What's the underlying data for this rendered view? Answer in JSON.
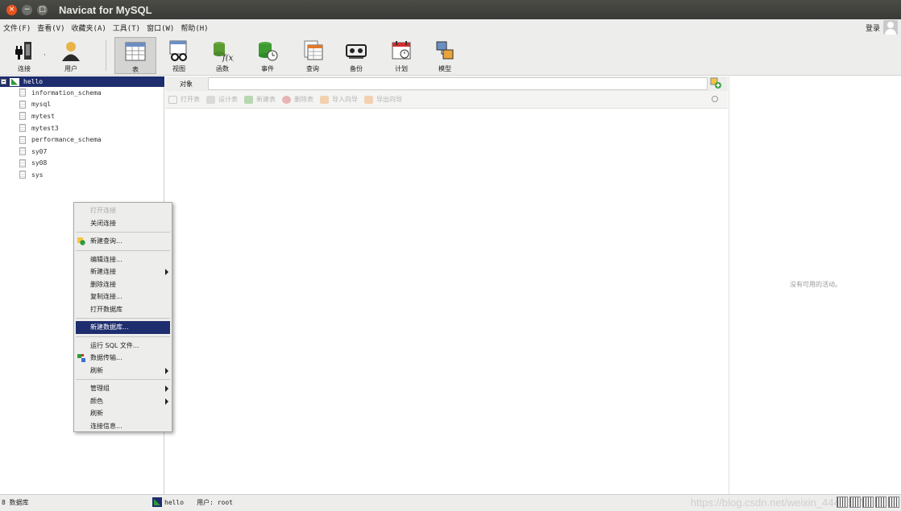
{
  "window": {
    "title": "Navicat for MySQL"
  },
  "menubar": {
    "items": [
      "文件(F)",
      "查看(V)",
      "收藏夹(A)",
      "工具(T)",
      "窗口(W)",
      "帮助(H)"
    ],
    "login": "登录"
  },
  "toolbar": {
    "items": [
      {
        "label": "连接",
        "icon": "plug-icon"
      },
      {
        "label": "用户",
        "icon": "user-icon"
      },
      {
        "label": "表",
        "icon": "table-icon"
      },
      {
        "label": "视图",
        "icon": "view-icon"
      },
      {
        "label": "函数",
        "icon": "function-icon"
      },
      {
        "label": "事件",
        "icon": "event-icon"
      },
      {
        "label": "查询",
        "icon": "query-icon"
      },
      {
        "label": "备份",
        "icon": "backup-icon"
      },
      {
        "label": "计划",
        "icon": "schedule-icon"
      },
      {
        "label": "模型",
        "icon": "model-icon"
      }
    ],
    "active": "表"
  },
  "tree": {
    "connection": "hello",
    "databases": [
      "information_schema",
      "mysql",
      "mytest",
      "mytest3",
      "performance_schema",
      "sy07",
      "sy08",
      "sys"
    ]
  },
  "object_tab": {
    "label": "对象"
  },
  "object_toolbar": [
    "打开表",
    "设计表",
    "新建表",
    "删除表",
    "导入向导",
    "导出向导"
  ],
  "context_menu": {
    "groups": [
      [
        {
          "label": "打开连接",
          "disabled": true
        },
        {
          "label": "关闭连接"
        }
      ],
      [
        {
          "label": "新建查询...",
          "icon": "new-query-icon"
        }
      ],
      [
        {
          "label": "编辑连接..."
        },
        {
          "label": "新建连接",
          "submenu": true
        },
        {
          "label": "删除连接"
        },
        {
          "label": "复制连接..."
        },
        {
          "label": "打开数据库"
        }
      ],
      [
        {
          "label": "新建数据库...",
          "selected": true
        }
      ],
      [
        {
          "label": "运行 SQL 文件..."
        },
        {
          "label": "数据传输...",
          "icon": "data-transfer-icon"
        },
        {
          "label": "刷新",
          "submenu": true
        }
      ],
      [
        {
          "label": "管理组",
          "submenu": true
        },
        {
          "label": "颜色",
          "submenu": true
        },
        {
          "label": "刷新"
        },
        {
          "label": "连接信息..."
        }
      ]
    ]
  },
  "right_panel": {
    "message": "没有可用的活动。"
  },
  "statusbar": {
    "left": "8 数据库",
    "connection": "hello",
    "user": "用户: root",
    "watermark": "https://blog.csdn.net/weixin_44415472"
  },
  "colors": {
    "selection": "#1e2d6e",
    "titlebar": "#3c3c38",
    "close": "#e9541f",
    "accent_green": "#2f9a3a"
  }
}
